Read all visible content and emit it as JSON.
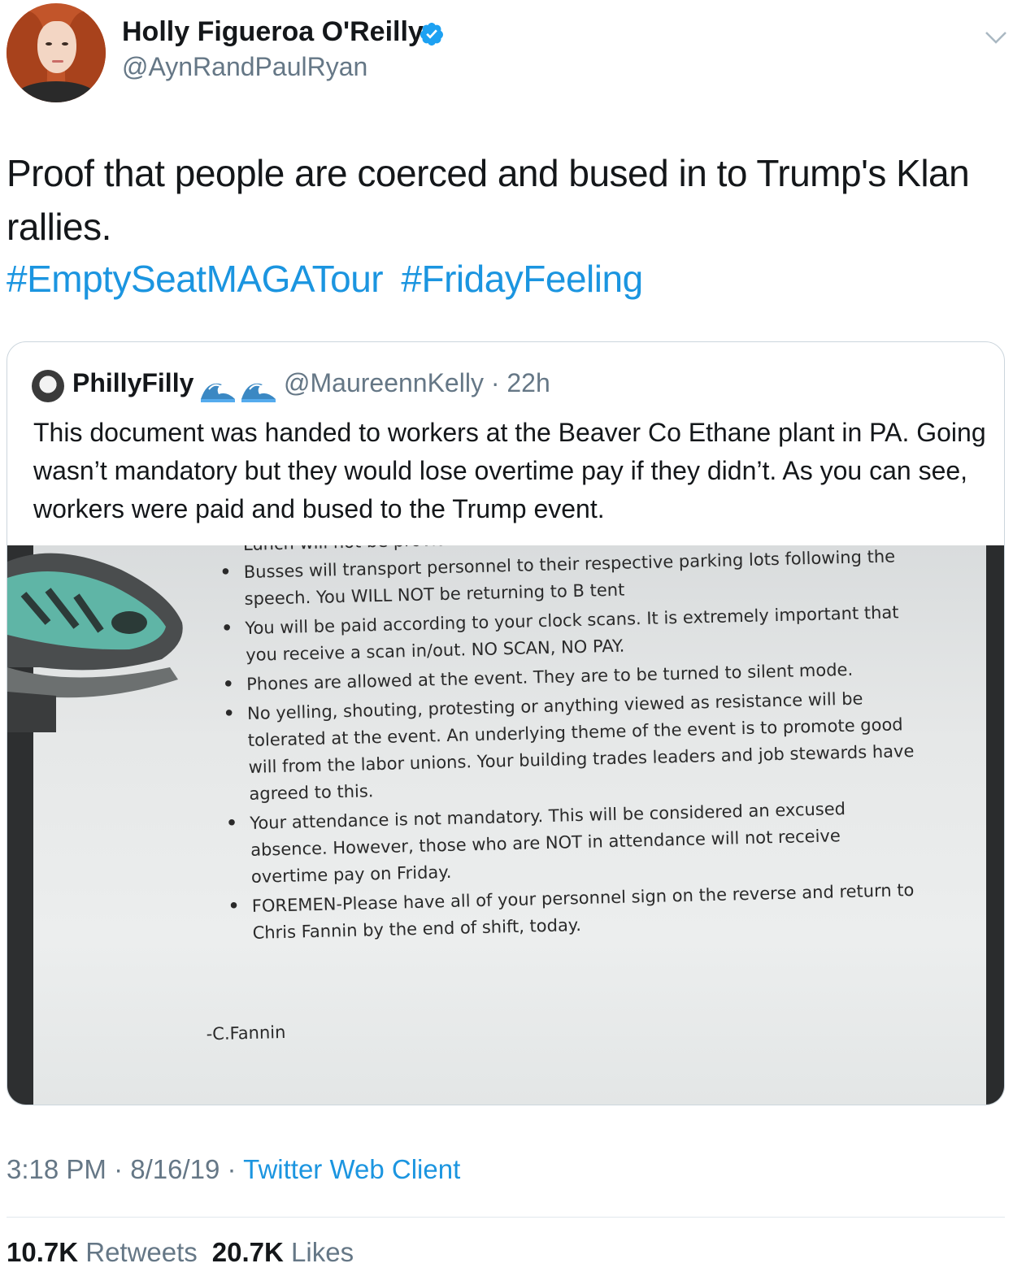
{
  "author": {
    "display_name": "Holly Figueroa O'Reilly",
    "handle": "@AynRandPaulRyan",
    "verified": true
  },
  "tweet": {
    "text": "Proof that people are coerced and bused in to Trump's Klan rallies.",
    "hashtags": [
      "#EmptySeatMAGATour",
      "#FridayFeeling"
    ]
  },
  "quoted_tweet": {
    "display_name": "PhillyFilly",
    "emoji": "wave-emoji",
    "handle_time": "@MaureennKelly · 22h",
    "text": "This document was handed to workers at the Beaver Co Ethane plant in PA. Going wasn’t mandatory but they would lose overtime pay if they didn’t. As you can see, workers were paid and bused to the Trump event.",
    "document": {
      "top_cut_text": "Lunch will not be provided",
      "bullets": [
        "Busses will transport personnel to their respective parking lots following the speech. You WILL NOT be returning to B tent",
        "You will be paid according to your clock scans. It is extremely important that you receive a scan in/out. NO SCAN, NO PAY.",
        "Phones are allowed at the event. They are to be turned to silent mode.",
        "No yelling, shouting, protesting or anything viewed as resistance will be tolerated at the event. An underlying theme of the event is to promote good will from the labor unions. Your building trades leaders and job stewards have agreed to this.",
        "Your attendance is not mandatory. This will be considered an excused absence. However, those who are NOT in attendance will not receive overtime pay on Friday.",
        "FOREMEN-Please have all of your personnel sign on the reverse and return to Chris Fannin by the end of shift, today."
      ],
      "signature": "-C.Fannin"
    }
  },
  "meta": {
    "time": "3:18 PM",
    "date": "8/16/19",
    "separator": "·",
    "client": "Twitter Web Client"
  },
  "stats": {
    "retweets_count": "10.7K",
    "retweets_label": "Retweets",
    "likes_count": "20.7K",
    "likes_label": "Likes"
  },
  "colors": {
    "link": "#1b95e0",
    "secondary_text": "#657786",
    "verified": "#1da1f2"
  }
}
